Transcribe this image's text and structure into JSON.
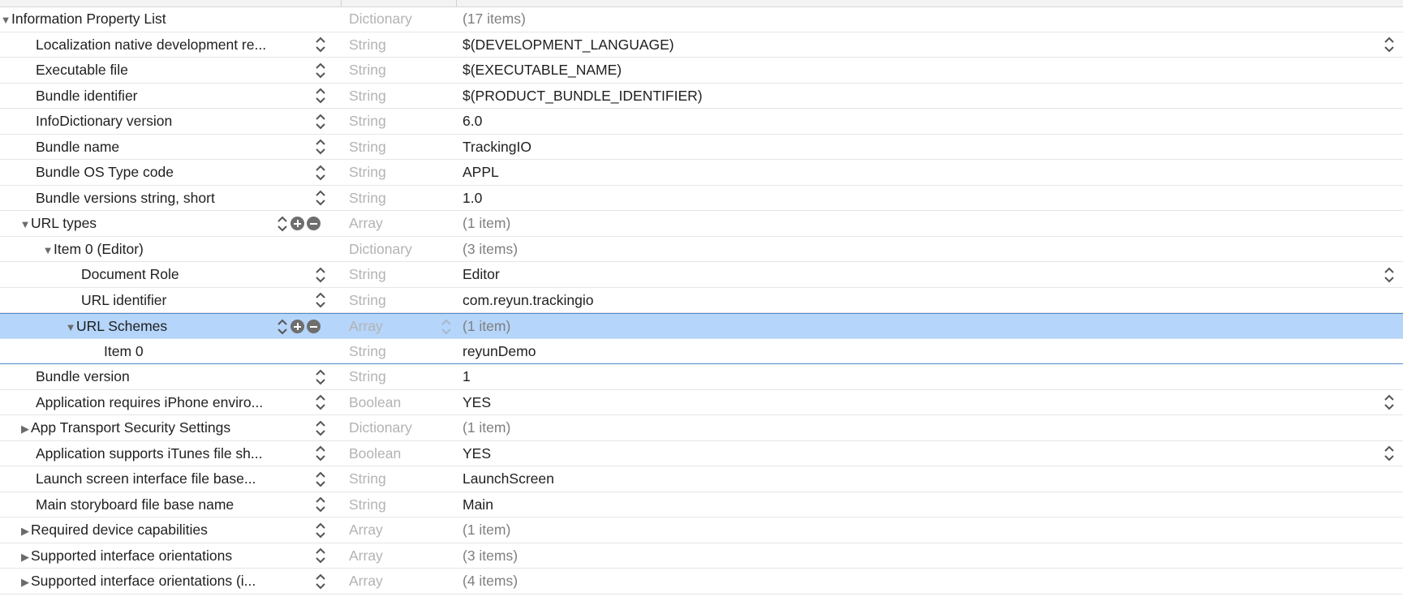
{
  "root": {
    "key": "Information Property List",
    "type": "Dictionary",
    "value": "(17 items)"
  },
  "rows": [
    {
      "key": "Localization native development re...",
      "type": "String",
      "value": "$(DEVELOPMENT_LANGUAGE)"
    },
    {
      "key": "Executable file",
      "type": "String",
      "value": "$(EXECUTABLE_NAME)"
    },
    {
      "key": "Bundle identifier",
      "type": "String",
      "value": "$(PRODUCT_BUNDLE_IDENTIFIER)"
    },
    {
      "key": "InfoDictionary version",
      "type": "String",
      "value": "6.0"
    },
    {
      "key": "Bundle name",
      "type": "String",
      "value": "TrackingIO"
    },
    {
      "key": "Bundle OS Type code",
      "type": "String",
      "value": "APPL"
    },
    {
      "key": "Bundle versions string, short",
      "type": "String",
      "value": "1.0"
    },
    {
      "key": "URL types",
      "type": "Array",
      "value": "(1 item)"
    },
    {
      "key": "Item 0 (Editor)",
      "type": "Dictionary",
      "value": "(3 items)"
    },
    {
      "key": "Document Role",
      "type": "String",
      "value": "Editor"
    },
    {
      "key": "URL identifier",
      "type": "String",
      "value": "com.reyun.trackingio"
    },
    {
      "key": "URL Schemes",
      "type": "Array",
      "value": "(1 item)"
    },
    {
      "key": "Item 0",
      "type": "String",
      "value": "reyunDemo"
    },
    {
      "key": "Bundle version",
      "type": "String",
      "value": "1"
    },
    {
      "key": "Application requires iPhone enviro...",
      "type": "Boolean",
      "value": "YES"
    },
    {
      "key": "App Transport Security Settings",
      "type": "Dictionary",
      "value": "(1 item)"
    },
    {
      "key": "Application supports iTunes file sh...",
      "type": "Boolean",
      "value": "YES"
    },
    {
      "key": "Launch screen interface file base...",
      "type": "String",
      "value": "LaunchScreen"
    },
    {
      "key": "Main storyboard file base name",
      "type": "String",
      "value": "Main"
    },
    {
      "key": "Required device capabilities",
      "type": "Array",
      "value": "(1 item)"
    },
    {
      "key": "Supported interface orientations",
      "type": "Array",
      "value": "(3 items)"
    },
    {
      "key": "Supported interface orientations (i...",
      "type": "Array",
      "value": "(4 items)"
    }
  ],
  "colors": {
    "selection": "#b5d5fa",
    "selection_border": "#4f8ac9",
    "type_text": "#b3b3b3",
    "count_text": "#7f7f7f"
  },
  "icons": {
    "expanded": "disclosure-expanded-icon",
    "collapsed": "disclosure-collapsed-icon",
    "stepper": "up-down-stepper-icon",
    "add": "add-circle-icon",
    "remove": "remove-circle-icon"
  }
}
